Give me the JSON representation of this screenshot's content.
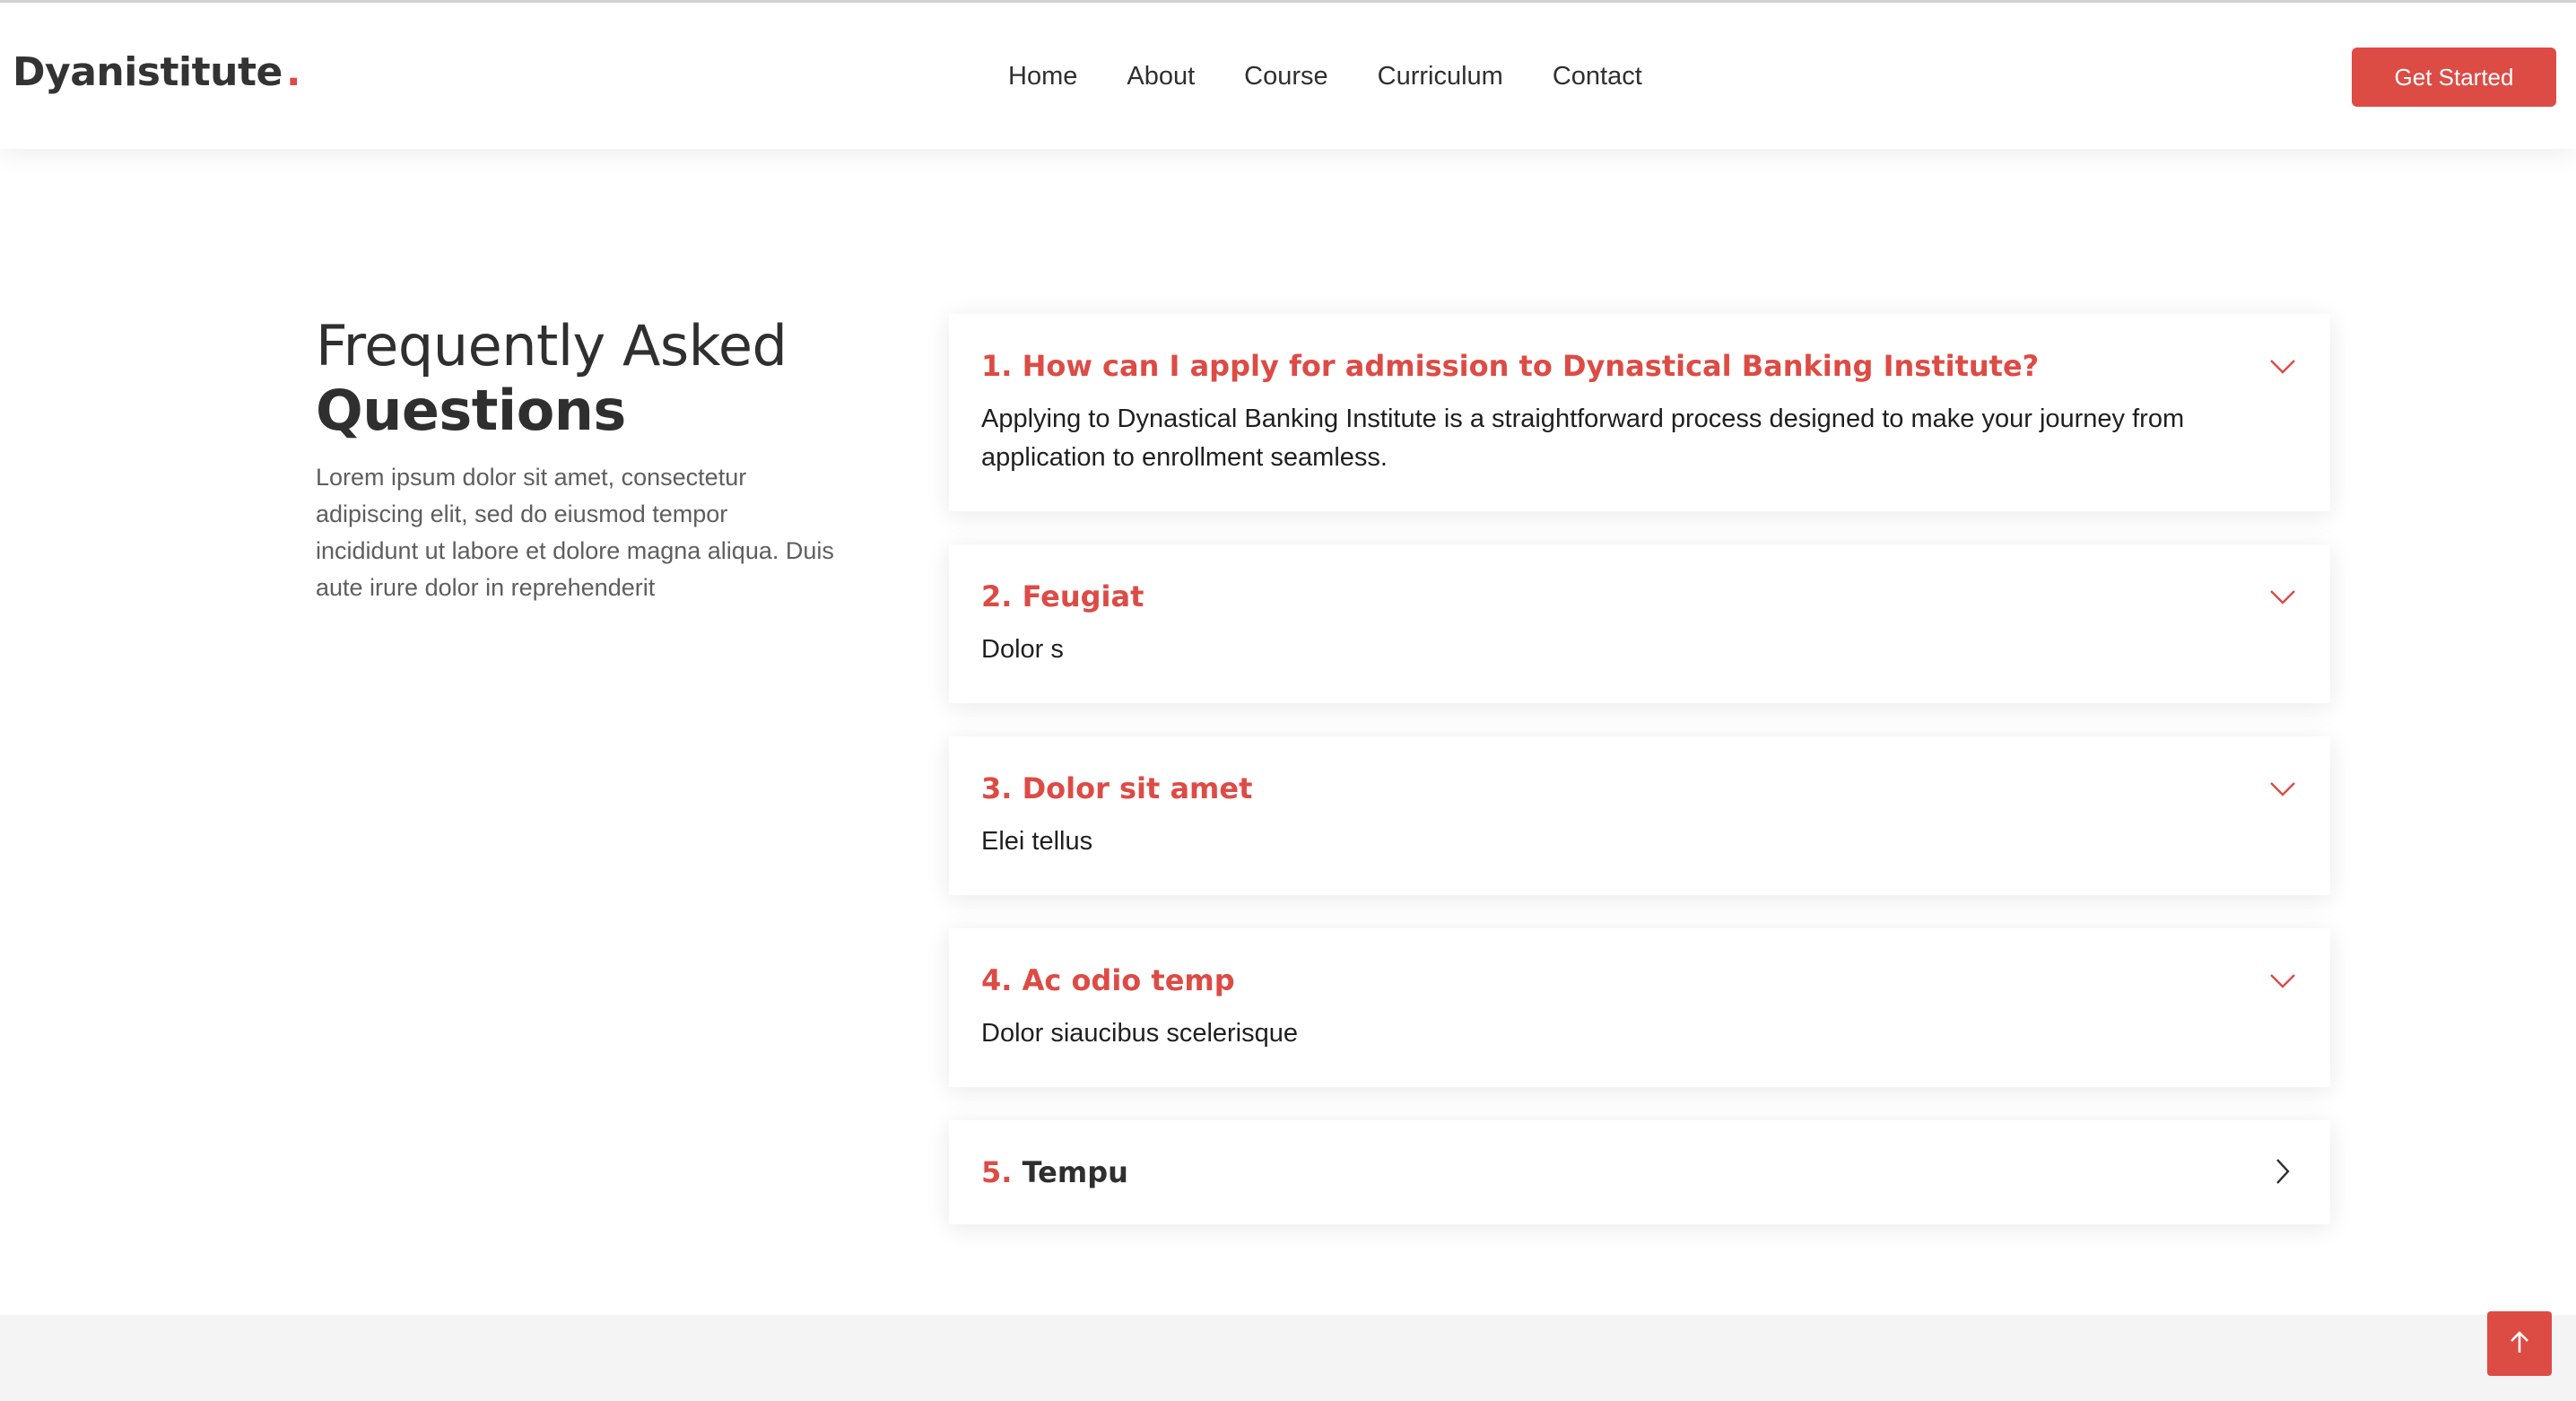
{
  "brand": {
    "name": "Dyanistitute",
    "dot": ".",
    "accent_color": "#dd4b45"
  },
  "nav": {
    "items": [
      {
        "label": "Home"
      },
      {
        "label": "About"
      },
      {
        "label": "Course"
      },
      {
        "label": "Curriculum"
      },
      {
        "label": "Contact"
      }
    ],
    "cta_label": "Get Started"
  },
  "intro": {
    "title_light": "Frequently Asked",
    "title_bold": "Questions",
    "body": "Lorem ipsum dolor sit amet, consectetur adipiscing elit, sed do eiusmod tempor incididunt ut labore et dolore magna aliqua. Duis aute irure dolor in reprehenderit"
  },
  "faq": {
    "items": [
      {
        "number": "1.",
        "question": "How can I apply for admission to Dynastical Banking Institute?",
        "answer": "Applying to Dynastical Banking Institute is a straightforward process designed to make your journey from application to enrollment seamless.",
        "expanded": true,
        "icon": "chevron-down-icon"
      },
      {
        "number": "2.",
        "question": "Feugiat",
        "answer": "Dolor s",
        "expanded": true,
        "icon": "chevron-down-icon"
      },
      {
        "number": "3.",
        "question": "Dolor sit amet",
        "answer": "Elei tellus",
        "expanded": true,
        "icon": "chevron-down-icon"
      },
      {
        "number": "4.",
        "question": "Ac odio temp",
        "answer": "Dolor siaucibus scelerisque",
        "expanded": true,
        "icon": "chevron-down-icon"
      },
      {
        "number": "5.",
        "question": "Tempu",
        "answer": "",
        "expanded": false,
        "icon": "chevron-right-icon"
      }
    ]
  },
  "scroll_top": {
    "icon": "arrow-up-icon"
  }
}
